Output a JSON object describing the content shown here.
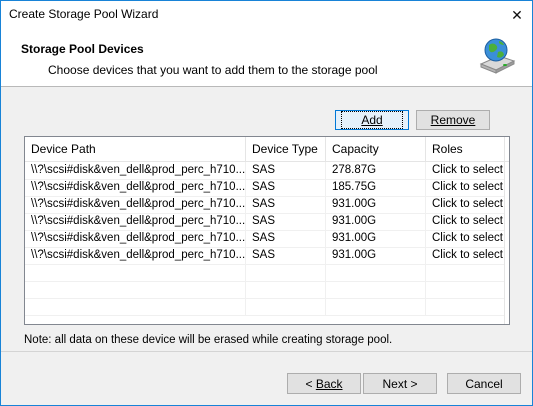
{
  "window": {
    "title": "Create Storage Pool Wizard",
    "close_glyph": "✕"
  },
  "header": {
    "title": "Storage Pool Devices",
    "subtitle": "Choose devices that you want to add them to the storage pool",
    "icon": "storage-globe-icon"
  },
  "toolbar": {
    "add_label": "Add",
    "remove_label": "Remove"
  },
  "table": {
    "columns": [
      "Device Path",
      "Device Type",
      "Capacity",
      "Roles"
    ],
    "rows": [
      [
        "\\\\?\\scsi#disk&ven_dell&prod_perc_h710...",
        "SAS",
        "278.87G",
        "Click to select"
      ],
      [
        "\\\\?\\scsi#disk&ven_dell&prod_perc_h710...",
        "SAS",
        "185.75G",
        "Click to select"
      ],
      [
        "\\\\?\\scsi#disk&ven_dell&prod_perc_h710...",
        "SAS",
        "931.00G",
        "Click to select"
      ],
      [
        "\\\\?\\scsi#disk&ven_dell&prod_perc_h710...",
        "SAS",
        "931.00G",
        "Click to select"
      ],
      [
        "\\\\?\\scsi#disk&ven_dell&prod_perc_h710...",
        "SAS",
        "931.00G",
        "Click to select"
      ],
      [
        "\\\\?\\scsi#disk&ven_dell&prod_perc_h710...",
        "SAS",
        "931.00G",
        "Click to select"
      ]
    ]
  },
  "note": "Note: all data on these device will be erased while creating storage pool.",
  "footer": {
    "back_label": "Back",
    "next_label": "Next >",
    "cancel_label": "Cancel"
  }
}
